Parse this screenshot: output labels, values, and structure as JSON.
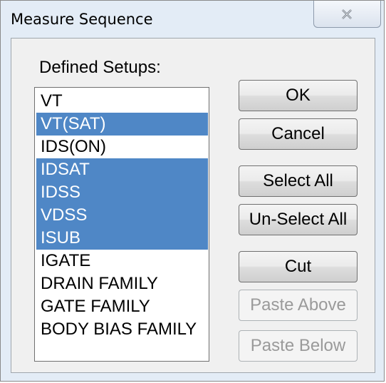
{
  "window": {
    "title": "Measure Sequence",
    "close_icon": "close-x-icon"
  },
  "setups": {
    "label": "Defined Setups:",
    "items": [
      {
        "label": "VT",
        "selected": false
      },
      {
        "label": "VT(SAT)",
        "selected": true
      },
      {
        "label": "IDS(ON)",
        "selected": false
      },
      {
        "label": "IDSAT",
        "selected": true
      },
      {
        "label": "IDSS",
        "selected": true
      },
      {
        "label": "VDSS",
        "selected": true
      },
      {
        "label": "ISUB",
        "selected": true
      },
      {
        "label": "IGATE",
        "selected": false
      },
      {
        "label": "DRAIN FAMILY",
        "selected": false
      },
      {
        "label": "GATE FAMILY",
        "selected": false
      },
      {
        "label": "BODY BIAS FAMILY",
        "selected": false
      }
    ]
  },
  "buttons": {
    "ok": "OK",
    "cancel": "Cancel",
    "select_all": "Select All",
    "unselect_all": "Un-Select All",
    "cut": "Cut",
    "paste_above": "Paste Above",
    "paste_below": "Paste Below"
  },
  "colors": {
    "selection": "#4f87c6",
    "disabled_text": "#9a9a9a"
  }
}
